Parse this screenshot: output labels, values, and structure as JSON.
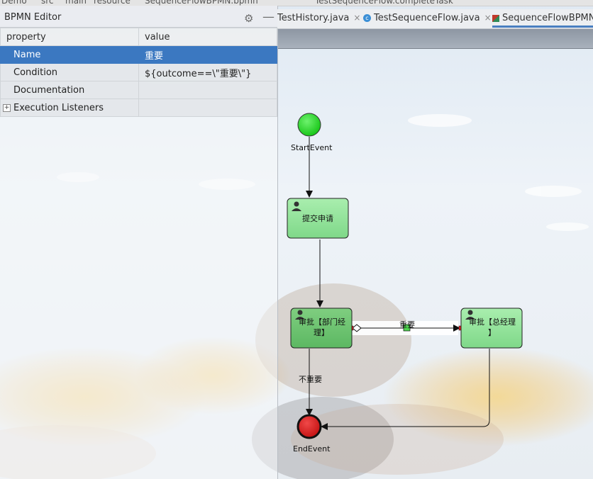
{
  "breadcrumb": [
    "Demo",
    "src",
    "main",
    "resource",
    "SequenceFlowBPMN.bpmn",
    "TestSequenceFlow.completeTask"
  ],
  "panel": {
    "title": "BPMN Editor",
    "columns": [
      "property",
      "value"
    ],
    "rows": [
      {
        "property": "Name",
        "value": "重要"
      },
      {
        "property": "Condition",
        "value": "${outcome==\\\"重要\\\"}"
      },
      {
        "property": "Documentation",
        "value": ""
      },
      {
        "property": "Execution Listeners",
        "value": ""
      }
    ]
  },
  "tabs": [
    {
      "label": "TestHistory.java",
      "close": "×"
    },
    {
      "label": "TestSequenceFlow.java",
      "close": "×"
    },
    {
      "label": "SequenceFlowBPMN.b",
      "close": ""
    }
  ],
  "diagram": {
    "start_label": "StartEvent",
    "end_label": "EndEvent",
    "task1_label": "提交申请",
    "task2_line1": "审批【部门经",
    "task2_line2": "理】",
    "task3_line1": "审批【总经理",
    "task3_line2": "】",
    "flow_important": "重要",
    "flow_not_important": "不重要"
  },
  "colors": {
    "selection": "#3b78c1",
    "task_fill": "#90e49a",
    "start_fill": "#22d422",
    "end_fill": "#dd1a1a"
  }
}
